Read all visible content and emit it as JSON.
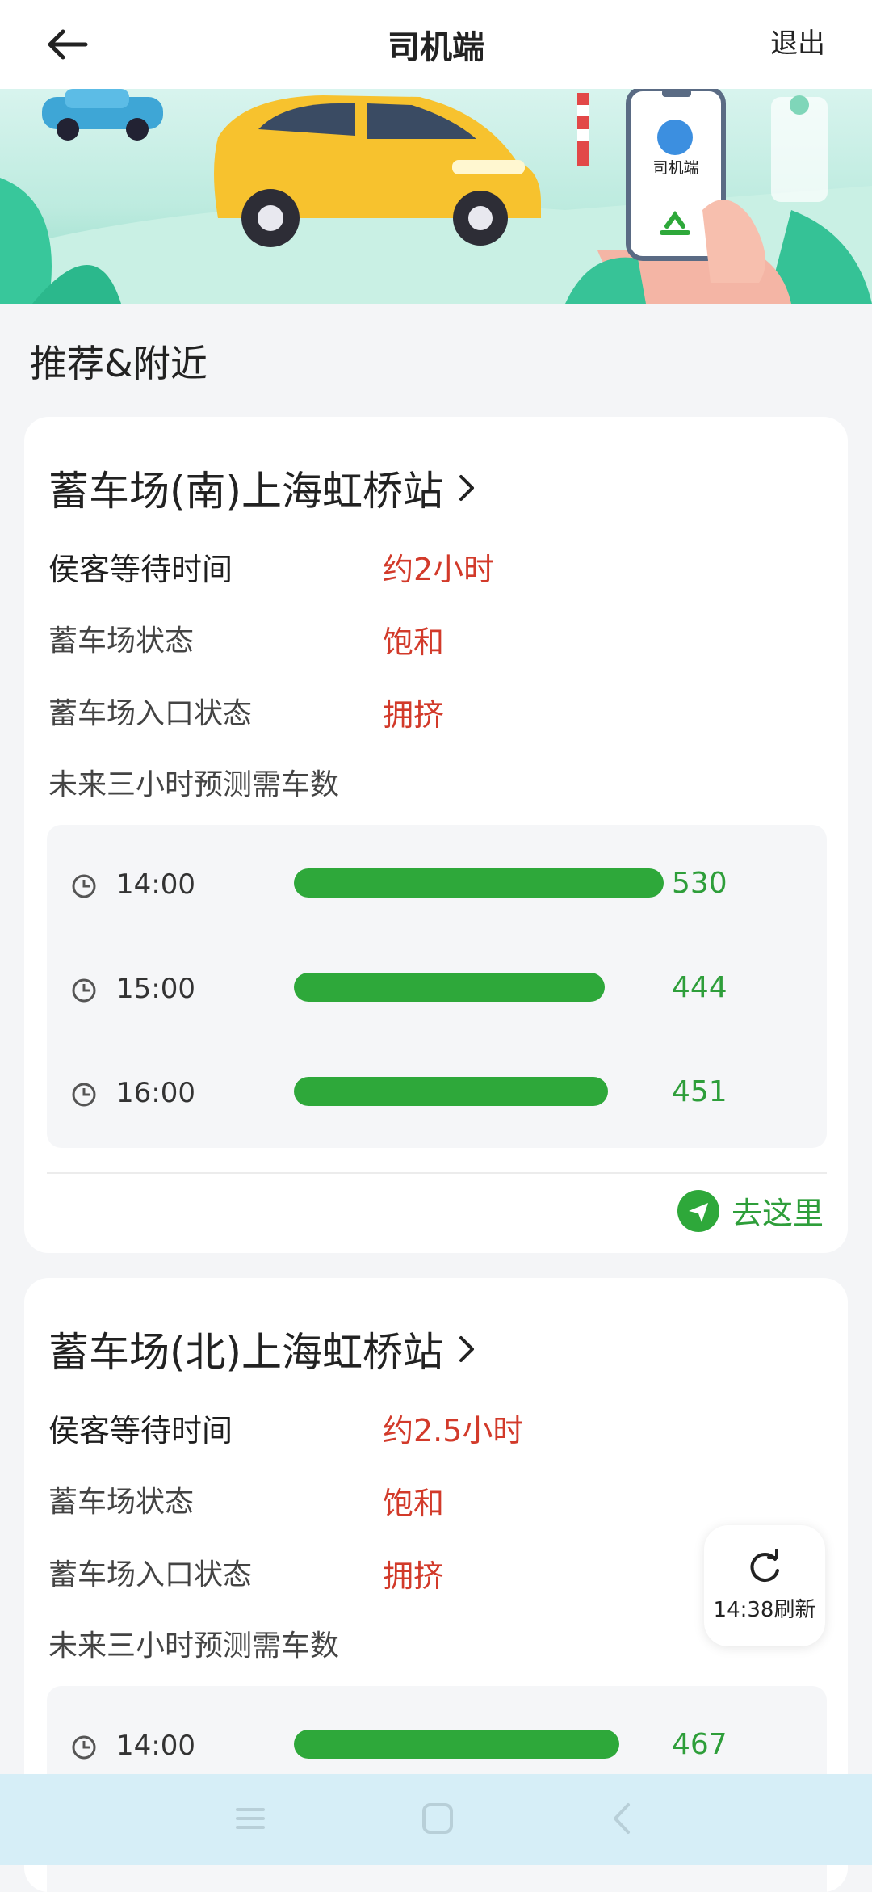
{
  "header": {
    "title": "司机端",
    "exit_label": "退出"
  },
  "banner": {
    "phone_label": "司机端"
  },
  "section_title": "推荐&附近",
  "cards": [
    {
      "title": "蓄车场(南)上海虹桥站",
      "wait_label": "侯客等待时间",
      "wait_value": "约2小时",
      "status_label": "蓄车场状态",
      "status_value": "饱和",
      "entrance_label": "蓄车场入口状态",
      "entrance_value": "拥挤",
      "forecast_label": "未来三小时预测需车数",
      "forecast": [
        {
          "time": "14:00",
          "count": "530",
          "fraction": 1.0
        },
        {
          "time": "15:00",
          "count": "444",
          "fraction": 0.84
        },
        {
          "time": "16:00",
          "count": "451",
          "fraction": 0.85
        }
      ],
      "goto_label": "去这里"
    },
    {
      "title": "蓄车场(北)上海虹桥站",
      "wait_label": "侯客等待时间",
      "wait_value": "约2.5小时",
      "status_label": "蓄车场状态",
      "status_value": "饱和",
      "entrance_label": "蓄车场入口状态",
      "entrance_value": "拥挤",
      "forecast_label": "未来三小时预测需车数",
      "forecast": [
        {
          "time": "14:00",
          "count": "467",
          "fraction": 0.88
        }
      ]
    }
  ],
  "refresh": {
    "label": "14:38刷新"
  },
  "colors": {
    "accent_green": "#2ea83a",
    "alert_red": "#d23a2a",
    "nav_bg": "#d6eef7"
  }
}
